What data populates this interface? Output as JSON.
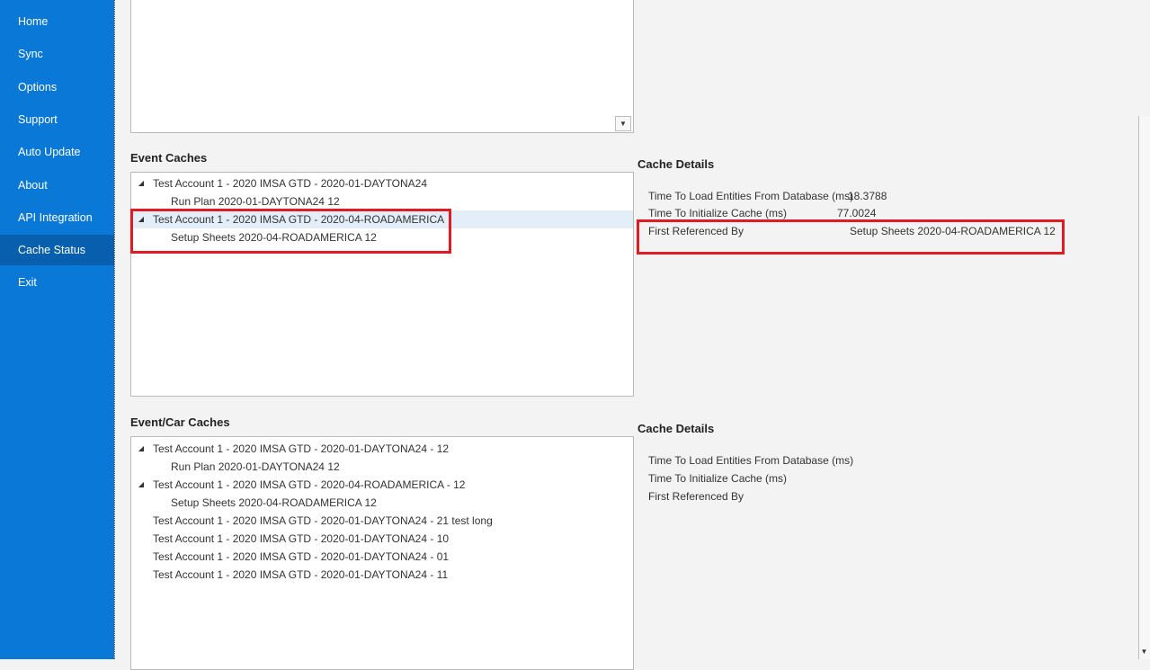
{
  "sidebar": {
    "items": [
      {
        "label": "Home"
      },
      {
        "label": "Sync"
      },
      {
        "label": "Options"
      },
      {
        "label": "Support"
      },
      {
        "label": "Auto Update"
      },
      {
        "label": "About"
      },
      {
        "label": "API Integration"
      },
      {
        "label": "Cache Status",
        "active": true
      },
      {
        "label": "Exit"
      }
    ]
  },
  "icons": {
    "expanded_arrow": "▲",
    "scroll_down": "▼"
  },
  "colors": {
    "sidebar_bg": "#0a78d7",
    "sidebar_active": "#075fae",
    "highlight_box": "#e01b24",
    "selected_row": "#e4eef8"
  },
  "event_caches": {
    "title": "Event Caches",
    "rows": [
      {
        "text": "Test Account 1 - 2020 IMSA GTD - 2020-01-DAYTONA24",
        "expanded": true
      },
      {
        "text": "Run Plan 2020-01-DAYTONA24 12",
        "child": true
      },
      {
        "text": "Test Account 1 - 2020 IMSA GTD - 2020-04-ROADAMERICA",
        "expanded": true,
        "selected": true
      },
      {
        "text": "Setup Sheets 2020-04-ROADAMERICA 12",
        "child": true
      }
    ]
  },
  "event_cache_details": {
    "title": "Cache Details",
    "rows": [
      {
        "label": "Time To Load Entities From Database (ms)",
        "value": "18.3788"
      },
      {
        "label": "Time To Initialize Cache (ms)",
        "value": "77.0024"
      },
      {
        "label": "First Referenced By",
        "value": "Setup Sheets 2020-04-ROADAMERICA 12"
      }
    ]
  },
  "event_car_caches": {
    "title": "Event/Car Caches",
    "rows": [
      {
        "text": "Test Account 1 - 2020 IMSA GTD - 2020-01-DAYTONA24 - 12",
        "expanded": true
      },
      {
        "text": "Run Plan 2020-01-DAYTONA24 12",
        "child": true
      },
      {
        "text": "Test Account 1 - 2020 IMSA GTD - 2020-04-ROADAMERICA - 12",
        "expanded": true
      },
      {
        "text": "Setup Sheets 2020-04-ROADAMERICA 12",
        "child": true
      },
      {
        "text": "Test Account 1 - 2020 IMSA GTD - 2020-01-DAYTONA24 - 21 test long"
      },
      {
        "text": "Test Account 1 - 2020 IMSA GTD - 2020-01-DAYTONA24 - 10"
      },
      {
        "text": "Test Account 1 - 2020 IMSA GTD - 2020-01-DAYTONA24 - 01"
      },
      {
        "text": "Test Account 1 - 2020 IMSA GTD - 2020-01-DAYTONA24 - 11"
      }
    ]
  },
  "event_car_cache_details": {
    "title": "Cache Details",
    "rows": [
      {
        "label": "Time To Load Entities From Database (ms)",
        "value": ""
      },
      {
        "label": "Time To Initialize Cache (ms)",
        "value": ""
      },
      {
        "label": "First Referenced By",
        "value": ""
      }
    ]
  }
}
